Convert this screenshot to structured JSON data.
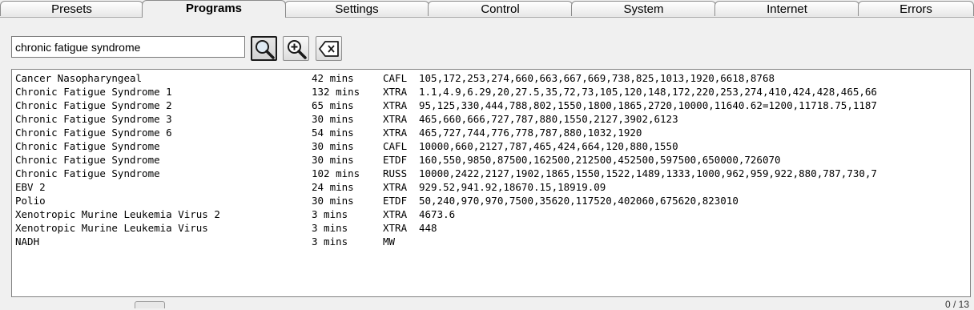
{
  "tabs": [
    {
      "label": "Presets"
    },
    {
      "label": "Programs"
    },
    {
      "label": "Settings"
    },
    {
      "label": "Control"
    },
    {
      "label": "System"
    },
    {
      "label": "Internet"
    },
    {
      "label": "Errors"
    }
  ],
  "active_tab": "Programs",
  "search": {
    "value": "chronic fatigue syndrome"
  },
  "buttons": {
    "search": "search-icon",
    "add": "zoom-in-icon",
    "clear": "backspace-icon"
  },
  "results": [
    {
      "name": "Cancer Nasopharyngeal",
      "duration": "42 mins",
      "type": "CAFL",
      "frequencies": "105,172,253,274,660,663,667,669,738,825,1013,1920,6618,8768"
    },
    {
      "name": "Chronic Fatigue Syndrome 1",
      "duration": "132 mins",
      "type": "XTRA",
      "frequencies": "1.1,4.9,6.29,20,27.5,35,72,73,105,120,148,172,220,253,274,410,424,428,465,66"
    },
    {
      "name": "Chronic Fatigue Syndrome 2",
      "duration": "65 mins",
      "type": "XTRA",
      "frequencies": "95,125,330,444,788,802,1550,1800,1865,2720,10000,11640.62=1200,11718.75,1187"
    },
    {
      "name": "Chronic Fatigue Syndrome 3",
      "duration": "30 mins",
      "type": "XTRA",
      "frequencies": "465,660,666,727,787,880,1550,2127,3902,6123"
    },
    {
      "name": "Chronic Fatigue Syndrome 6",
      "duration": "54 mins",
      "type": "XTRA",
      "frequencies": "465,727,744,776,778,787,880,1032,1920"
    },
    {
      "name": "Chronic Fatigue Syndrome",
      "duration": "30 mins",
      "type": "CAFL",
      "frequencies": "10000,660,2127,787,465,424,664,120,880,1550"
    },
    {
      "name": "Chronic Fatigue Syndrome",
      "duration": "30 mins",
      "type": "ETDF",
      "frequencies": "160,550,9850,87500,162500,212500,452500,597500,650000,726070"
    },
    {
      "name": "Chronic Fatigue Syndrome",
      "duration": "102 mins",
      "type": "RUSS",
      "frequencies": "10000,2422,2127,1902,1865,1550,1522,1489,1333,1000,962,959,922,880,787,730,7"
    },
    {
      "name": "EBV 2",
      "duration": "24 mins",
      "type": "XTRA",
      "frequencies": "929.52,941.92,18670.15,18919.09"
    },
    {
      "name": "Polio",
      "duration": "30 mins",
      "type": "ETDF",
      "frequencies": "50,240,970,970,7500,35620,117520,402060,675620,823010"
    },
    {
      "name": "Xenotropic Murine Leukemia Virus 2",
      "duration": "3 mins",
      "type": "XTRA",
      "frequencies": "4673.6"
    },
    {
      "name": "Xenotropic Murine Leukemia Virus",
      "duration": "3 mins",
      "type": "XTRA",
      "frequencies": "448"
    },
    {
      "name": "NADH",
      "duration": "3 mins",
      "type": "MW",
      "frequencies": ""
    }
  ],
  "pager": "0 / 13"
}
